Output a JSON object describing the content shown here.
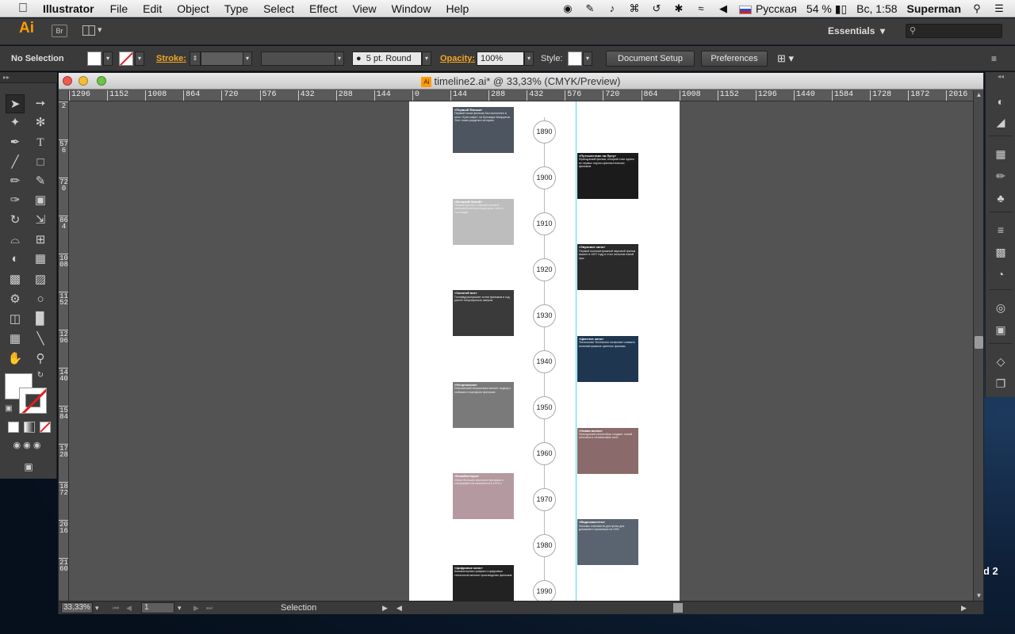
{
  "menubar": {
    "apple_icon": "apple-icon",
    "app_name": "Illustrator",
    "items": [
      "File",
      "Edit",
      "Object",
      "Type",
      "Select",
      "Effect",
      "View",
      "Window",
      "Help"
    ],
    "status": {
      "keyboard_layout": "Русская",
      "battery": "54 %",
      "clock": "Вс, 1:58",
      "user": "Superman"
    }
  },
  "appbar": {
    "logo": "Ai",
    "bridge_label": "Br",
    "workspace": "Essentials",
    "search_placeholder": ""
  },
  "control": {
    "selection_label": "No Selection",
    "stroke_label": "Stroke:",
    "brush_label": "5 pt. Round",
    "opacity_label": "Opacity:",
    "opacity_value": "100%",
    "style_label": "Style:",
    "document_setup_label": "Document Setup",
    "preferences_label": "Preferences"
  },
  "document": {
    "title": "timeline2.ai* @ 33,33% (CMYK/Preview)",
    "ruler_ticks": [
      "1296",
      "1152",
      "1008",
      "864",
      "720",
      "576",
      "432",
      "288",
      "144",
      "0",
      "144",
      "288",
      "432",
      "576",
      "720",
      "864",
      "1008",
      "1152",
      "1296",
      "1440",
      "1584",
      "1728",
      "1872",
      "2016"
    ],
    "vruler_ticks": [
      "2",
      "576",
      "720",
      "864",
      "1008",
      "1152",
      "1296",
      "1440",
      "1584",
      "1728",
      "1872",
      "2016",
      "2160"
    ],
    "years": [
      "1890",
      "1900",
      "1910",
      "1920",
      "1930",
      "1940",
      "1950",
      "1960",
      "1970",
      "1980",
      "1990"
    ],
    "cards": [
      {
        "title": "«Первый Фильм»",
        "text": "Первый показ фильма был выполнен в зале «Гран кафе» на бульваре Капуцинок. Этот показ разделил историю",
        "bg": "#4c5560"
      },
      {
        "title": "«Путешествие на Луну»",
        "text": "Французский фильм, который стал одним из первых научно-фантастических фильмов",
        "bg": "#1b1b1b"
      },
      {
        "title": "«Великий Немой»",
        "text": "Первый фильм, ставший основой американской киноиндустрии, снят в Голливуде",
        "bg": "#bdbdbd"
      },
      {
        "title": "«Звуковое кино»",
        "text": "Первый полнометражный звуковой фильм вышел в 1927 году и стал началом новой эры",
        "bg": "#2a2a2a"
      },
      {
        "title": "«Золотой век»",
        "text": "Голливуд выпускает сотни фильмов в год, растёт популярность жанров",
        "bg": "#3a3a3a"
      },
      {
        "title": "«Цветное кино»",
        "text": "Технология Technicolor позволяет снимать полнометражные цветные фильмы",
        "bg": "#1f3650"
      },
      {
        "title": "«Неореализм»",
        "text": "Итальянский неореализм меняет подход к съёмкам и сценарию фильмов",
        "bg": "#7a7a7a"
      },
      {
        "title": "«Новая волна»",
        "text": "Французские режиссёры создают новый киноязык и независимое кино",
        "bg": "#8a6a6a"
      },
      {
        "title": "«Блокбастеры»",
        "text": "Эпоха больших кассовых фильмов и спецэффектов начинается в 1970-х",
        "bg": "#b49aa0"
      },
      {
        "title": "«Видеокассеты»",
        "text": "Фильмы становятся доступны для домашнего просмотра на VHS",
        "bg": "#5a6470"
      },
      {
        "title": "«Цифровое кино»",
        "text": "Компьютерная графика и цифровые технологии меняют производство фильмов",
        "bg": "#222222"
      }
    ]
  },
  "status": {
    "zoom": "33,33%",
    "page": "1",
    "tool_name": "Selection"
  },
  "desktop": {
    "side_text": "d 2"
  },
  "colors": {
    "accent": "#ff9a00",
    "guide": "#4fd8e8",
    "stroke_none": "#e02020"
  }
}
